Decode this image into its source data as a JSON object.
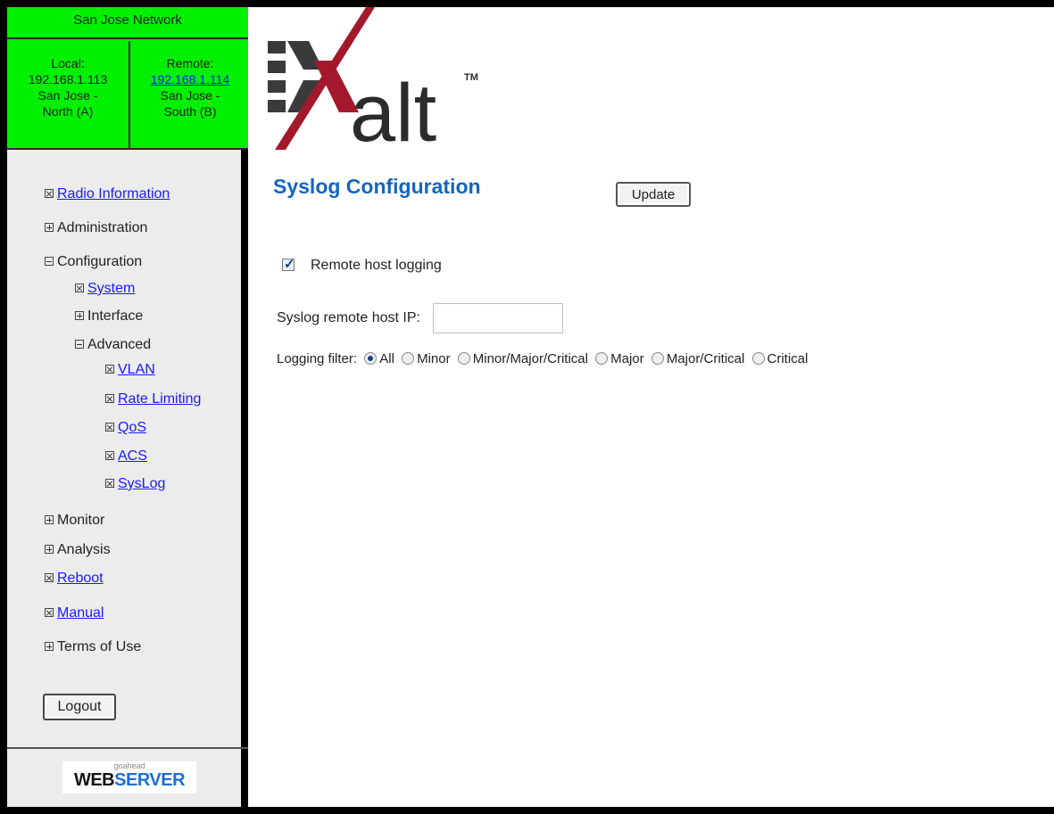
{
  "network": {
    "title": "San Jose Network",
    "local": {
      "label": "Local:",
      "ip": "192.168.1.113",
      "site_line1": "San Jose -",
      "site_line2": "North (A)"
    },
    "remote": {
      "label": "Remote:",
      "ip": "192.168.1.114",
      "site_line1": "San Jose -",
      "site_line2": "South (B)"
    },
    "color": "#00f000"
  },
  "menu": {
    "radio_information": "Radio Information",
    "administration": "Administration",
    "configuration": "Configuration",
    "system": "System",
    "interface": "Interface",
    "advanced": "Advanced",
    "vlan": "VLAN",
    "rate_limiting": "Rate Limiting",
    "qos": "QoS",
    "acs": "ACS",
    "syslog": "SysLog",
    "monitor": "Monitor",
    "analysis": "Analysis",
    "reboot": "Reboot",
    "manual": "Manual",
    "terms_of_use": "Terms of Use",
    "logout": "Logout"
  },
  "footer": {
    "small": "goahead",
    "web": "WEB",
    "server": "SERVER"
  },
  "logo": {
    "text": "alt",
    "tm": "TM",
    "color_bar": "#3a3a3a",
    "color_x": "#a3182b"
  },
  "page": {
    "title": "Syslog Configuration",
    "update_button": "Update",
    "remote_host_logging": {
      "label": "Remote host logging",
      "checked": true
    },
    "host_ip": {
      "label": "Syslog remote host IP:",
      "value": ""
    },
    "logging_filter": {
      "label": "Logging filter:",
      "options": [
        "All",
        "Minor",
        "Minor/Major/Critical",
        "Major",
        "Major/Critical",
        "Critical"
      ],
      "selected": "All"
    },
    "title_color": "#1565c0"
  }
}
